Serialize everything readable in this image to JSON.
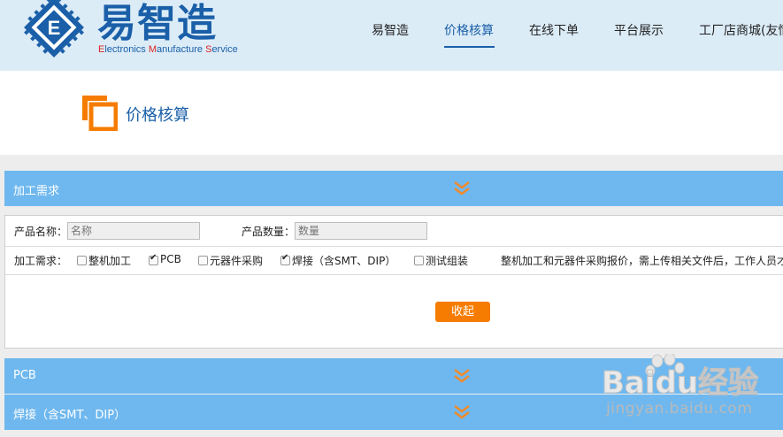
{
  "brand": {
    "name_cn": "易智造",
    "tagline_parts": [
      "E",
      "lectronics ",
      "M",
      "anufacture ",
      "S",
      "ervice"
    ]
  },
  "nav": {
    "items": [
      "易智造",
      "价格核算",
      "在线下单",
      "平台展示",
      "工厂店商城(友情"
    ],
    "active_index": 1
  },
  "page_title": "价格核算",
  "sections": {
    "processing": "加工需求",
    "pcb": "PCB",
    "welding": "焊接（含SMT、DIP）"
  },
  "form": {
    "product_name_label": "产品名称：",
    "product_name_placeholder": "名称",
    "product_qty_label": "产品数量：",
    "product_qty_placeholder": "数量",
    "requirements_label": "加工需求：",
    "options": [
      {
        "label": "整机加工",
        "checked": false
      },
      {
        "label": "PCB",
        "checked": true
      },
      {
        "label": "元器件采购",
        "checked": false
      },
      {
        "label": "焊接（含SMT、DIP）",
        "checked": true
      },
      {
        "label": "测试组装",
        "checked": false
      }
    ],
    "notice": "整机加工和元器件采购报价，需上传相关文件后，工作人员才",
    "collapse_button": "收起"
  },
  "watermark": {
    "logo": "Baidu经验",
    "url": "jingyan.baidu.com"
  },
  "colors": {
    "brand_blue": "#1a5fa8",
    "section_blue": "#6fb8ef",
    "accent_orange": "#f57c00",
    "header_bg": "#dcecf7"
  }
}
